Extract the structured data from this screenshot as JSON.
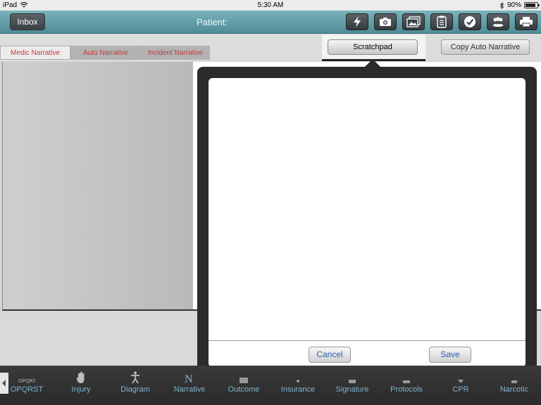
{
  "status_bar": {
    "device": "iPad",
    "time": "5:30 AM",
    "battery": "90%",
    "battery_level": 0.9
  },
  "header": {
    "inbox_label": "Inbox",
    "patient_label": "Patient:",
    "icons": [
      "lightning-icon",
      "camera-icon",
      "photos-icon",
      "clipboard-icon",
      "checkmark-icon",
      "people-icon",
      "printer-icon"
    ]
  },
  "tabs": {
    "items": [
      {
        "label": "Medic Narrative",
        "active": true
      },
      {
        "label": "Auto Narrative",
        "active": false
      },
      {
        "label": "Incident Narrative",
        "active": false
      }
    ],
    "scratchpad_label": "Scratchpad",
    "copy_label": "Copy Auto Narrative"
  },
  "scratchpad": {
    "text": "",
    "cancel_label": "Cancel",
    "save_label": "Save"
  },
  "toolbar": {
    "items": [
      {
        "label": "OPQRST",
        "icon": "opqrst-icon"
      },
      {
        "label": "Injury",
        "icon": "hand-icon"
      },
      {
        "label": "Diagram",
        "icon": "body-diagram-icon"
      },
      {
        "label": "Narrative",
        "icon": "narrative-icon"
      },
      {
        "label": "Outcome",
        "icon": "outcome-icon"
      },
      {
        "label": "Insurance",
        "icon": "insurance-icon"
      },
      {
        "label": "Signature",
        "icon": "signature-icon"
      },
      {
        "label": "Protocols",
        "icon": "protocols-icon"
      },
      {
        "label": "CPR",
        "icon": "cpr-icon"
      },
      {
        "label": "Narcotic",
        "icon": "narcotic-icon"
      }
    ]
  },
  "colors": {
    "header_teal": "#5f9ea7",
    "tab_text": "#c0393b",
    "link_blue": "#2a62b0",
    "toolbar_label": "#7fb2d2"
  }
}
